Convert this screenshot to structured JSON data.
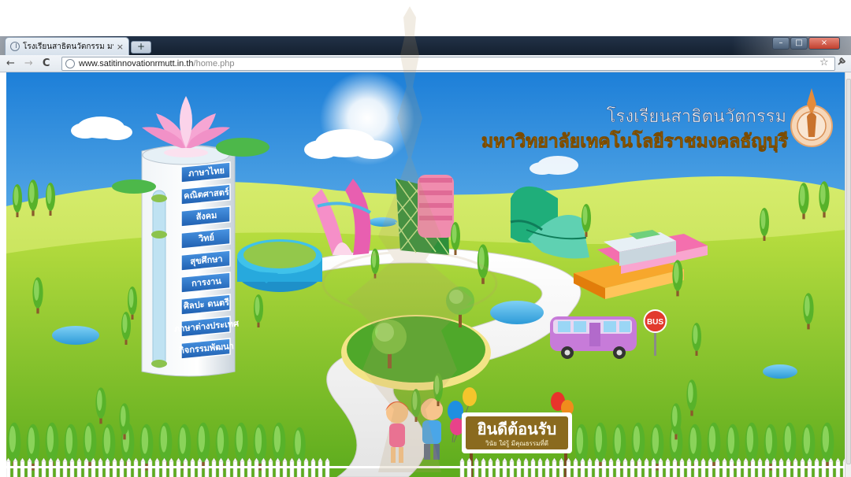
{
  "browser": {
    "tab_title": "โรงเรียนสาธิตนวัตกรรม มหาวิ",
    "tab_close": "×",
    "newtab_label": "+",
    "nav": {
      "back": "←",
      "forward": "→",
      "reload": "C"
    },
    "url_host": "www.satitinnovationrmutt.in.th",
    "url_path": "/home.php",
    "star": "☆",
    "wrench": "🔧",
    "window_buttons": {
      "minimize": "–",
      "maximize": "□",
      "close": "×"
    }
  },
  "site": {
    "title_line1": "โรงเรียนสาธิตนวัตกรรม",
    "title_line2": "มหาวิทยาลัยเทคโนโลยีราชมงคลธัญบุรี",
    "menu": [
      {
        "label": "ภาษาไทย"
      },
      {
        "label": "คณิตศาสตร์"
      },
      {
        "label": "สังคม"
      },
      {
        "label": "วิทย์"
      },
      {
        "label": "สุขศึกษา"
      },
      {
        "label": "การงาน"
      },
      {
        "label": "ศิลปะ ดนตรี"
      },
      {
        "label": "ภาษาต่างประเทศ"
      },
      {
        "label": "กิจกรรมพัฒนา"
      }
    ],
    "bus_sign": "BUS",
    "welcome_title": "ยินดีต้อนรับ",
    "welcome_sub": "วินัย ใฝ่รู้ มีคุณธรรมที่ดี"
  },
  "colors": {
    "sky_top": "#1d7fd8",
    "sky_bottom": "#9fd5f4",
    "grass_light": "#c9e64a",
    "grass_dark": "#5cab1d",
    "menu_blue": "#2c76c9",
    "title_gold": "#f7c22b"
  }
}
